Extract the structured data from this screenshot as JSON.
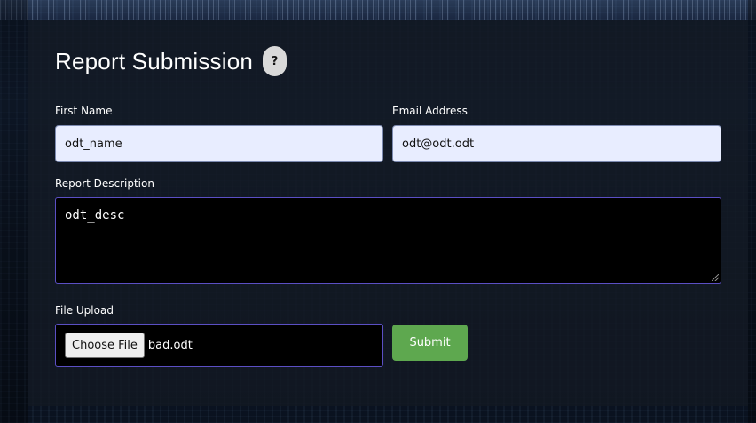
{
  "form": {
    "title": "Report Submission",
    "help_label": "?",
    "first_name": {
      "label": "First Name",
      "value": "odt_name"
    },
    "email": {
      "label": "Email Address",
      "value": "odt@odt.odt"
    },
    "description": {
      "label": "Report Description",
      "value": "odt_desc"
    },
    "file_upload": {
      "label": "File Upload",
      "button_label": "Choose File",
      "file_name": "bad.odt"
    },
    "submit_label": "Submit"
  },
  "colors": {
    "submit": "#5ea84f",
    "input_bg": "#e8edff",
    "field_border": "#5b4fc4",
    "panel": "#121822"
  }
}
